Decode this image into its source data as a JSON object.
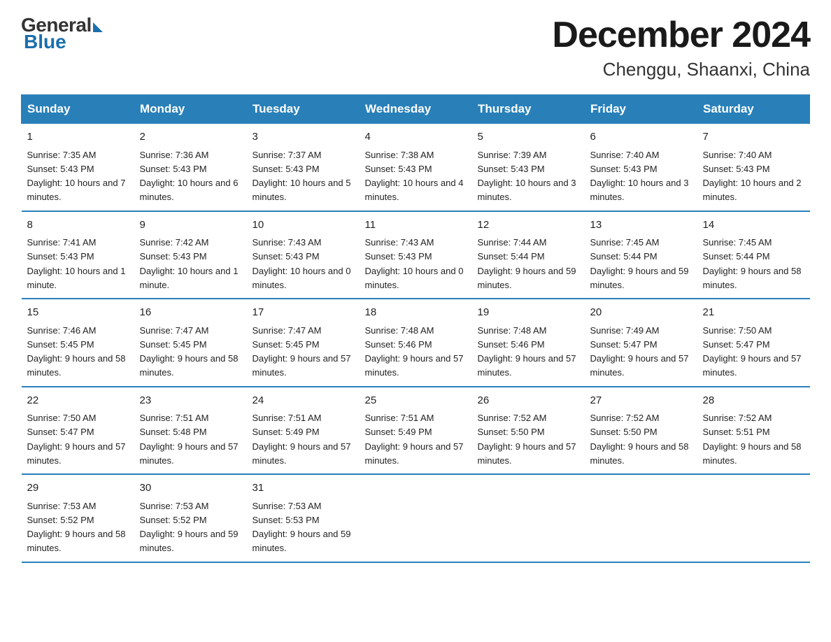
{
  "header": {
    "logo_general": "General",
    "logo_blue": "Blue",
    "month_title": "December 2024",
    "location": "Chenggu, Shaanxi, China"
  },
  "calendar": {
    "days_of_week": [
      "Sunday",
      "Monday",
      "Tuesday",
      "Wednesday",
      "Thursday",
      "Friday",
      "Saturday"
    ],
    "weeks": [
      [
        {
          "day": "1",
          "sunrise": "7:35 AM",
          "sunset": "5:43 PM",
          "daylight": "10 hours and 7 minutes."
        },
        {
          "day": "2",
          "sunrise": "7:36 AM",
          "sunset": "5:43 PM",
          "daylight": "10 hours and 6 minutes."
        },
        {
          "day": "3",
          "sunrise": "7:37 AM",
          "sunset": "5:43 PM",
          "daylight": "10 hours and 5 minutes."
        },
        {
          "day": "4",
          "sunrise": "7:38 AM",
          "sunset": "5:43 PM",
          "daylight": "10 hours and 4 minutes."
        },
        {
          "day": "5",
          "sunrise": "7:39 AM",
          "sunset": "5:43 PM",
          "daylight": "10 hours and 3 minutes."
        },
        {
          "day": "6",
          "sunrise": "7:40 AM",
          "sunset": "5:43 PM",
          "daylight": "10 hours and 3 minutes."
        },
        {
          "day": "7",
          "sunrise": "7:40 AM",
          "sunset": "5:43 PM",
          "daylight": "10 hours and 2 minutes."
        }
      ],
      [
        {
          "day": "8",
          "sunrise": "7:41 AM",
          "sunset": "5:43 PM",
          "daylight": "10 hours and 1 minute."
        },
        {
          "day": "9",
          "sunrise": "7:42 AM",
          "sunset": "5:43 PM",
          "daylight": "10 hours and 1 minute."
        },
        {
          "day": "10",
          "sunrise": "7:43 AM",
          "sunset": "5:43 PM",
          "daylight": "10 hours and 0 minutes."
        },
        {
          "day": "11",
          "sunrise": "7:43 AM",
          "sunset": "5:43 PM",
          "daylight": "10 hours and 0 minutes."
        },
        {
          "day": "12",
          "sunrise": "7:44 AM",
          "sunset": "5:44 PM",
          "daylight": "9 hours and 59 minutes."
        },
        {
          "day": "13",
          "sunrise": "7:45 AM",
          "sunset": "5:44 PM",
          "daylight": "9 hours and 59 minutes."
        },
        {
          "day": "14",
          "sunrise": "7:45 AM",
          "sunset": "5:44 PM",
          "daylight": "9 hours and 58 minutes."
        }
      ],
      [
        {
          "day": "15",
          "sunrise": "7:46 AM",
          "sunset": "5:45 PM",
          "daylight": "9 hours and 58 minutes."
        },
        {
          "day": "16",
          "sunrise": "7:47 AM",
          "sunset": "5:45 PM",
          "daylight": "9 hours and 58 minutes."
        },
        {
          "day": "17",
          "sunrise": "7:47 AM",
          "sunset": "5:45 PM",
          "daylight": "9 hours and 57 minutes."
        },
        {
          "day": "18",
          "sunrise": "7:48 AM",
          "sunset": "5:46 PM",
          "daylight": "9 hours and 57 minutes."
        },
        {
          "day": "19",
          "sunrise": "7:48 AM",
          "sunset": "5:46 PM",
          "daylight": "9 hours and 57 minutes."
        },
        {
          "day": "20",
          "sunrise": "7:49 AM",
          "sunset": "5:47 PM",
          "daylight": "9 hours and 57 minutes."
        },
        {
          "day": "21",
          "sunrise": "7:50 AM",
          "sunset": "5:47 PM",
          "daylight": "9 hours and 57 minutes."
        }
      ],
      [
        {
          "day": "22",
          "sunrise": "7:50 AM",
          "sunset": "5:47 PM",
          "daylight": "9 hours and 57 minutes."
        },
        {
          "day": "23",
          "sunrise": "7:51 AM",
          "sunset": "5:48 PM",
          "daylight": "9 hours and 57 minutes."
        },
        {
          "day": "24",
          "sunrise": "7:51 AM",
          "sunset": "5:49 PM",
          "daylight": "9 hours and 57 minutes."
        },
        {
          "day": "25",
          "sunrise": "7:51 AM",
          "sunset": "5:49 PM",
          "daylight": "9 hours and 57 minutes."
        },
        {
          "day": "26",
          "sunrise": "7:52 AM",
          "sunset": "5:50 PM",
          "daylight": "9 hours and 57 minutes."
        },
        {
          "day": "27",
          "sunrise": "7:52 AM",
          "sunset": "5:50 PM",
          "daylight": "9 hours and 58 minutes."
        },
        {
          "day": "28",
          "sunrise": "7:52 AM",
          "sunset": "5:51 PM",
          "daylight": "9 hours and 58 minutes."
        }
      ],
      [
        {
          "day": "29",
          "sunrise": "7:53 AM",
          "sunset": "5:52 PM",
          "daylight": "9 hours and 58 minutes."
        },
        {
          "day": "30",
          "sunrise": "7:53 AM",
          "sunset": "5:52 PM",
          "daylight": "9 hours and 59 minutes."
        },
        {
          "day": "31",
          "sunrise": "7:53 AM",
          "sunset": "5:53 PM",
          "daylight": "9 hours and 59 minutes."
        },
        null,
        null,
        null,
        null
      ]
    ]
  }
}
